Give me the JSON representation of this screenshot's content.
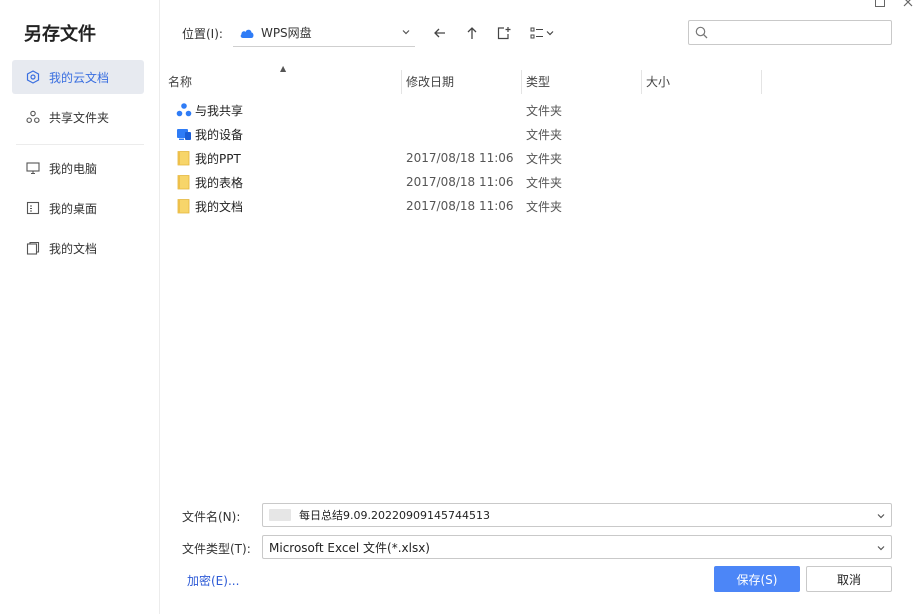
{
  "dialog": {
    "title": "另存文件"
  },
  "sidebar": {
    "items": [
      {
        "label": "我的云文档",
        "icon": "cloud-doc-icon",
        "active": true
      },
      {
        "label": "共享文件夹",
        "icon": "share-folder-icon"
      },
      {
        "label": "我的电脑",
        "icon": "computer-icon"
      },
      {
        "label": "我的桌面",
        "icon": "desktop-icon"
      },
      {
        "label": "我的文档",
        "icon": "documents-icon"
      }
    ]
  },
  "toolbar": {
    "location_label": "位置(I):",
    "location_value": "WPS网盘",
    "search_placeholder": ""
  },
  "columns": {
    "name": "名称",
    "date": "修改日期",
    "type": "类型",
    "size": "大小"
  },
  "files": [
    {
      "name": "与我共享",
      "date": "",
      "type": "文件夹",
      "icon": "share-icon"
    },
    {
      "name": "我的设备",
      "date": "",
      "type": "文件夹",
      "icon": "device-icon"
    },
    {
      "name": "我的PPT",
      "date": "2017/08/18 11:06",
      "type": "文件夹",
      "icon": "folder-icon"
    },
    {
      "name": "我的表格",
      "date": "2017/08/18 11:06",
      "type": "文件夹",
      "icon": "folder-icon"
    },
    {
      "name": "我的文档",
      "date": "2017/08/18 11:06",
      "type": "文件夹",
      "icon": "folder-icon"
    }
  ],
  "form": {
    "filename_label": "文件名(N):",
    "filename_value": "每日总结9.09.20220909145744513",
    "filetype_label": "文件类型(T):",
    "filetype_value": "Microsoft Excel 文件(*.xlsx)"
  },
  "actions": {
    "encrypt_label": "加密(E)...",
    "save_label": "保存(S)",
    "cancel_label": "取消"
  },
  "colors": {
    "accent": "#4c86f7",
    "active_bg": "#e7eaf0",
    "folder": "#f7d56a"
  }
}
